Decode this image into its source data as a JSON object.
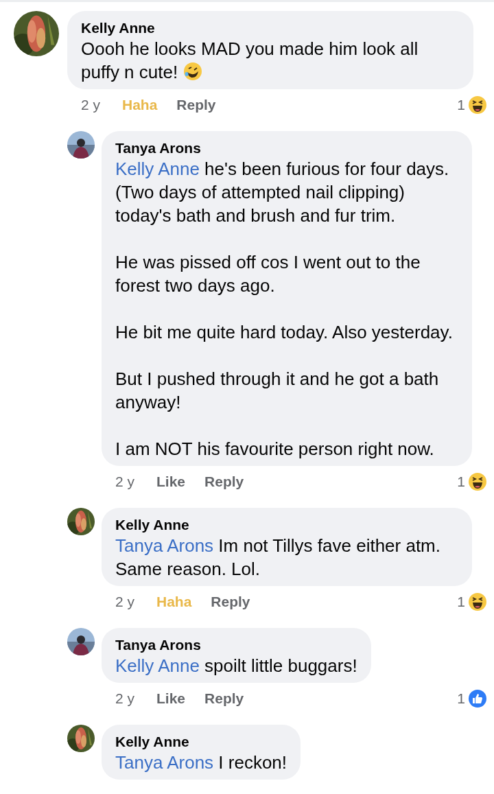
{
  "comments": [
    {
      "author": "Kelly Anne",
      "avatar": {
        "kind": "flower"
      },
      "nested": false,
      "paragraphs": [
        "Oooh he looks MAD you made him look all puffy n cute!"
      ],
      "inline_emoji": true,
      "time": "2 y",
      "like": {
        "label": "Haha",
        "selected": true
      },
      "reply": "Reply",
      "reaction": {
        "count": "1",
        "kind": "haha"
      }
    },
    {
      "author": "Tanya Arons",
      "avatar": {
        "kind": "person"
      },
      "nested": true,
      "mention": "Kelly Anne",
      "paragraphs": [
        "he's been furious for four days. (Two days of attempted nail clipping) today's bath and brush and fur trim.",
        "He was pissed off cos I went out to the forest two days ago.",
        "He bit me quite hard today.  Also yesterday.",
        "But I pushed through it and he got a bath anyway!",
        "I am NOT his favourite person right now."
      ],
      "inline_emoji": false,
      "time": "2 y",
      "like": {
        "label": "Like",
        "selected": false
      },
      "reply": "Reply",
      "reaction": {
        "count": "1",
        "kind": "haha"
      }
    },
    {
      "author": "Kelly Anne",
      "avatar": {
        "kind": "flower"
      },
      "nested": true,
      "mention": "Tanya Arons",
      "paragraphs": [
        "Im not Tillys fave either atm. Same reason. Lol."
      ],
      "inline_emoji": false,
      "time": "2 y",
      "like": {
        "label": "Haha",
        "selected": true
      },
      "reply": "Reply",
      "reaction": {
        "count": "1",
        "kind": "haha"
      }
    },
    {
      "author": "Tanya Arons",
      "avatar": {
        "kind": "person"
      },
      "nested": true,
      "mention": "Kelly Anne",
      "paragraphs": [
        "spoilt little buggars!"
      ],
      "inline_emoji": false,
      "time": "2 y",
      "like": {
        "label": "Like",
        "selected": false
      },
      "reply": "Reply",
      "reaction": {
        "count": "1",
        "kind": "like"
      }
    },
    {
      "author": "Kelly Anne",
      "avatar": {
        "kind": "flower"
      },
      "nested": true,
      "mention": "Tanya Arons",
      "paragraphs": [
        "I reckon!"
      ],
      "inline_emoji": false
    }
  ]
}
